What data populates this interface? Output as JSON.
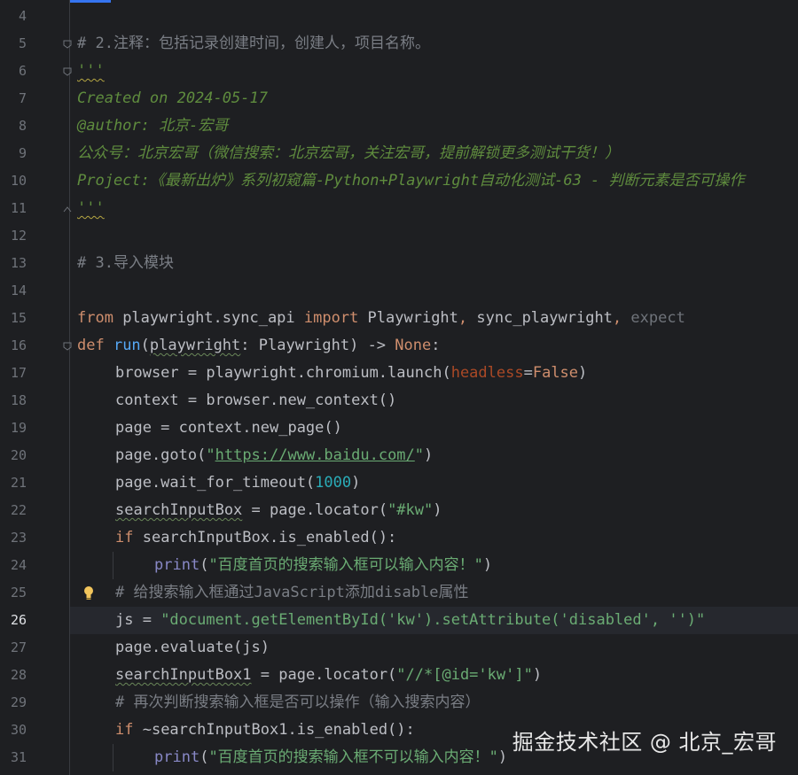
{
  "editor": {
    "lines": [
      {
        "num": "4"
      },
      {
        "num": "5",
        "segments": [
          {
            "t": "# 2.注释：包括记录创建时间，创建人，项目名称。",
            "c": "c-comment"
          }
        ]
      },
      {
        "num": "6",
        "segments": [
          {
            "t": "'''",
            "c": "c-doc squiggle-doc"
          }
        ]
      },
      {
        "num": "7",
        "segments": [
          {
            "t": "Created on 2024-05-17",
            "c": "c-doc"
          }
        ]
      },
      {
        "num": "8",
        "segments": [
          {
            "t": "@author: 北京-宏哥",
            "c": "c-doc"
          }
        ]
      },
      {
        "num": "9",
        "segments": [
          {
            "t": "公众号：北京宏哥（微信搜索：北京宏哥，关注宏哥，提前解锁更多测试干货！）",
            "c": "c-doc"
          }
        ]
      },
      {
        "num": "10",
        "segments": [
          {
            "t": "Project:《最新出炉》系列初窥篇-Python+Playwright自动化测试-63 - 判断元素是否可操作",
            "c": "c-doc"
          }
        ]
      },
      {
        "num": "11",
        "segments": [
          {
            "t": "'''",
            "c": "c-doc squiggle-doc"
          }
        ]
      },
      {
        "num": "12"
      },
      {
        "num": "13",
        "segments": [
          {
            "t": "# 3.导入模块",
            "c": "c-comment"
          }
        ]
      },
      {
        "num": "14"
      },
      {
        "num": "15",
        "segments": [
          {
            "t": "from ",
            "c": "c-kw"
          },
          {
            "t": "playwright.sync_api ",
            "c": ""
          },
          {
            "t": "import ",
            "c": "c-kw"
          },
          {
            "t": "Playwright",
            "c": ""
          },
          {
            "t": ", ",
            "c": "c-kw"
          },
          {
            "t": "sync_playwright",
            "c": ""
          },
          {
            "t": ", ",
            "c": "c-kw"
          },
          {
            "t": "expect",
            "c": "c-dim"
          }
        ]
      },
      {
        "num": "16",
        "segments": [
          {
            "t": "def ",
            "c": "c-kw"
          },
          {
            "t": "run",
            "c": "c-fn"
          },
          {
            "t": "(",
            "c": ""
          },
          {
            "t": "playwright",
            "c": "squiggle"
          },
          {
            "t": ": Playwright) -> ",
            "c": ""
          },
          {
            "t": "None",
            "c": "c-kw"
          },
          {
            "t": ":",
            "c": ""
          }
        ]
      },
      {
        "num": "17",
        "indent": 1,
        "segments": [
          {
            "t": "browser = playwright.chromium.launch(",
            "c": ""
          },
          {
            "t": "headless",
            "c": "c-param"
          },
          {
            "t": "=",
            "c": ""
          },
          {
            "t": "False",
            "c": "c-kw"
          },
          {
            "t": ")",
            "c": ""
          }
        ]
      },
      {
        "num": "18",
        "indent": 1,
        "segments": [
          {
            "t": "context = browser.new_context()",
            "c": ""
          }
        ]
      },
      {
        "num": "19",
        "indent": 1,
        "segments": [
          {
            "t": "page = context.new_page()",
            "c": ""
          }
        ]
      },
      {
        "num": "20",
        "indent": 1,
        "segments": [
          {
            "t": "page.goto(",
            "c": ""
          },
          {
            "t": "\"",
            "c": "c-str"
          },
          {
            "t": "https://www.baidu.com/",
            "c": "c-url"
          },
          {
            "t": "\"",
            "c": "c-str"
          },
          {
            "t": ")",
            "c": ""
          }
        ]
      },
      {
        "num": "21",
        "indent": 1,
        "segments": [
          {
            "t": "page.wait_for_timeout(",
            "c": ""
          },
          {
            "t": "1000",
            "c": "c-num"
          },
          {
            "t": ")",
            "c": ""
          }
        ]
      },
      {
        "num": "22",
        "indent": 1,
        "segments": [
          {
            "t": "searchInputBox",
            "c": "squiggle"
          },
          {
            "t": " = page.locator(",
            "c": ""
          },
          {
            "t": "\"#kw\"",
            "c": "c-str"
          },
          {
            "t": ")",
            "c": ""
          }
        ]
      },
      {
        "num": "23",
        "indent": 1,
        "segments": [
          {
            "t": "if ",
            "c": "c-kw"
          },
          {
            "t": "searchInputBox.is_enabled():",
            "c": ""
          }
        ]
      },
      {
        "num": "24",
        "indent": 2,
        "segments": [
          {
            "t": "print",
            "c": "c-builtin"
          },
          {
            "t": "(",
            "c": ""
          },
          {
            "t": "\"百度首页的搜索输入框可以输入内容！\"",
            "c": "c-str"
          },
          {
            "t": ")",
            "c": ""
          }
        ]
      },
      {
        "num": "25",
        "indent": 1,
        "bulb": true,
        "segments": [
          {
            "t": "# 给搜索输入框通过JavaScript添加disable属性",
            "c": "c-comment"
          }
        ]
      },
      {
        "num": "26",
        "indent": 1,
        "current": true,
        "segments": [
          {
            "t": "js = ",
            "c": ""
          },
          {
            "t": "\"document.getElementById('kw').setAttribute('disabled', '')\"",
            "c": "c-str"
          }
        ]
      },
      {
        "num": "27",
        "indent": 1,
        "segments": [
          {
            "t": "page.evaluate(js)",
            "c": ""
          }
        ]
      },
      {
        "num": "28",
        "indent": 1,
        "segments": [
          {
            "t": "searchInputBox1",
            "c": "squiggle"
          },
          {
            "t": " = page.locator(",
            "c": ""
          },
          {
            "t": "\"//*[@id='kw']\"",
            "c": "c-str"
          },
          {
            "t": ")",
            "c": ""
          }
        ]
      },
      {
        "num": "29",
        "indent": 1,
        "segments": [
          {
            "t": "# 再次判断搜索输入框是否可以操作（输入搜索内容）",
            "c": "c-comment"
          }
        ]
      },
      {
        "num": "30",
        "indent": 1,
        "segments": [
          {
            "t": "if ",
            "c": "c-kw"
          },
          {
            "t": "~searchInputBox1.is_enabled():",
            "c": ""
          }
        ]
      },
      {
        "num": "31",
        "indent": 2,
        "segments": [
          {
            "t": "print",
            "c": "c-builtin"
          },
          {
            "t": "(",
            "c": ""
          },
          {
            "t": "\"百度首页的搜索输入框不可以输入内容！\"",
            "c": "c-str"
          },
          {
            "t": ")",
            "c": ""
          }
        ]
      }
    ]
  },
  "watermark": {
    "text": "掘金技术社区 @ 北京_宏哥"
  },
  "colors": {
    "background": "#1e1f22",
    "keyword": "#cf8e6d",
    "string": "#6aab73",
    "comment": "#7a7e85",
    "docstring": "#5f8c3e",
    "number": "#2aacb8",
    "function": "#56a8f5",
    "accent": "#3574f0"
  },
  "icons": {
    "bulb": "lightbulb-icon",
    "fold": "fold-marker-icon"
  }
}
